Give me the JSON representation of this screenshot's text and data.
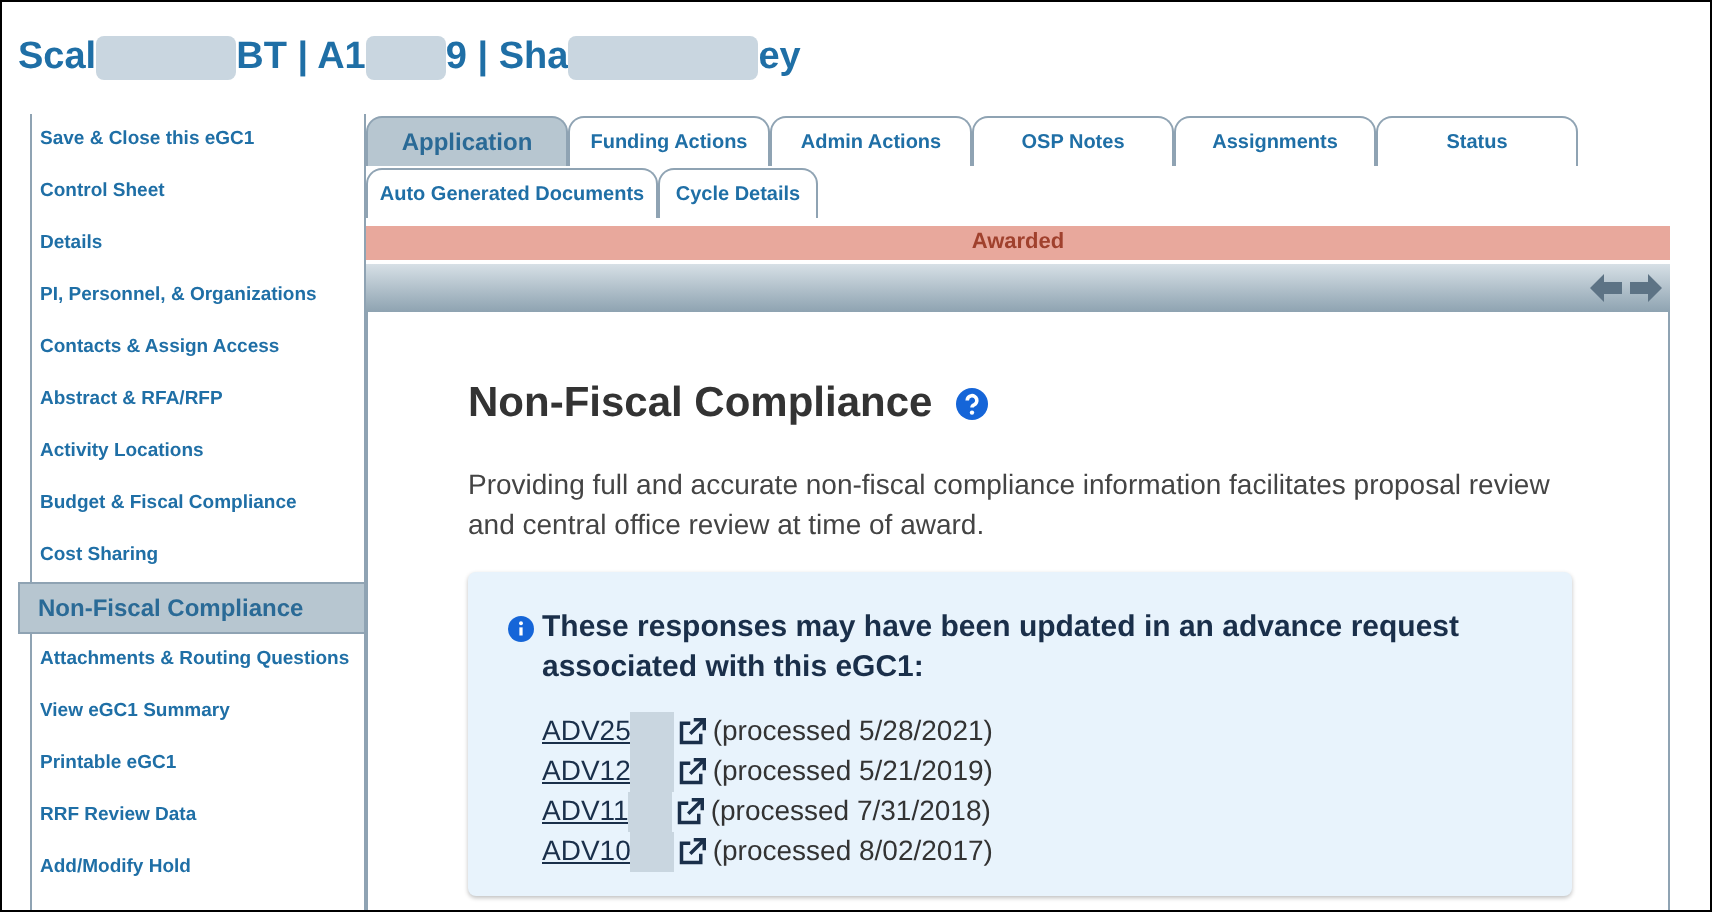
{
  "header": {
    "title_parts": [
      "Scal",
      "BT | A1",
      "9 | Sha",
      "ey"
    ]
  },
  "sidebar": {
    "items": [
      {
        "label": "Save & Close this eGC1",
        "selected": false
      },
      {
        "label": "Control Sheet",
        "selected": false
      },
      {
        "label": "Details",
        "selected": false
      },
      {
        "label": "PI, Personnel, & Organizations",
        "selected": false
      },
      {
        "label": "Contacts & Assign Access",
        "selected": false
      },
      {
        "label": "Abstract & RFA/RFP",
        "selected": false
      },
      {
        "label": "Activity Locations",
        "selected": false
      },
      {
        "label": "Budget & Fiscal Compliance",
        "selected": false
      },
      {
        "label": "Cost Sharing",
        "selected": false
      },
      {
        "label": "Non-Fiscal Compliance",
        "selected": true
      },
      {
        "label": "Attachments & Routing Questions",
        "selected": false
      },
      {
        "label": "View eGC1 Summary",
        "selected": false
      },
      {
        "label": "Printable eGC1",
        "selected": false
      },
      {
        "label": "RRF Review Data",
        "selected": false
      },
      {
        "label": "Add/Modify Hold",
        "selected": false
      }
    ]
  },
  "tabs": [
    [
      {
        "label": "Application",
        "selected": true
      },
      {
        "label": "Funding Actions",
        "selected": false
      },
      {
        "label": "Admin Actions",
        "selected": false
      },
      {
        "label": "OSP Notes",
        "selected": false
      },
      {
        "label": "Assignments",
        "selected": false
      },
      {
        "label": "Status",
        "selected": false
      }
    ],
    [
      {
        "label": "Auto Generated Documents",
        "selected": false
      },
      {
        "label": "Cycle Details",
        "selected": false
      }
    ]
  ],
  "status_banner": "Awarded",
  "content": {
    "heading": "Non-Fiscal Compliance",
    "description": "Providing full and accurate non-fiscal compliance information facilitates proposal review and central office review at time of award.",
    "notice": {
      "message": "These responses may have been updated in an advance request associated with this eGC1:",
      "requests": [
        {
          "link": "ADV25",
          "note": "(processed 5/28/2021)"
        },
        {
          "link": "ADV12",
          "note": "(processed 5/21/2019)"
        },
        {
          "link": "ADV11",
          "note": "(processed 7/31/2018)"
        },
        {
          "link": "ADV10",
          "note": "(processed 8/02/2017)"
        }
      ]
    }
  }
}
